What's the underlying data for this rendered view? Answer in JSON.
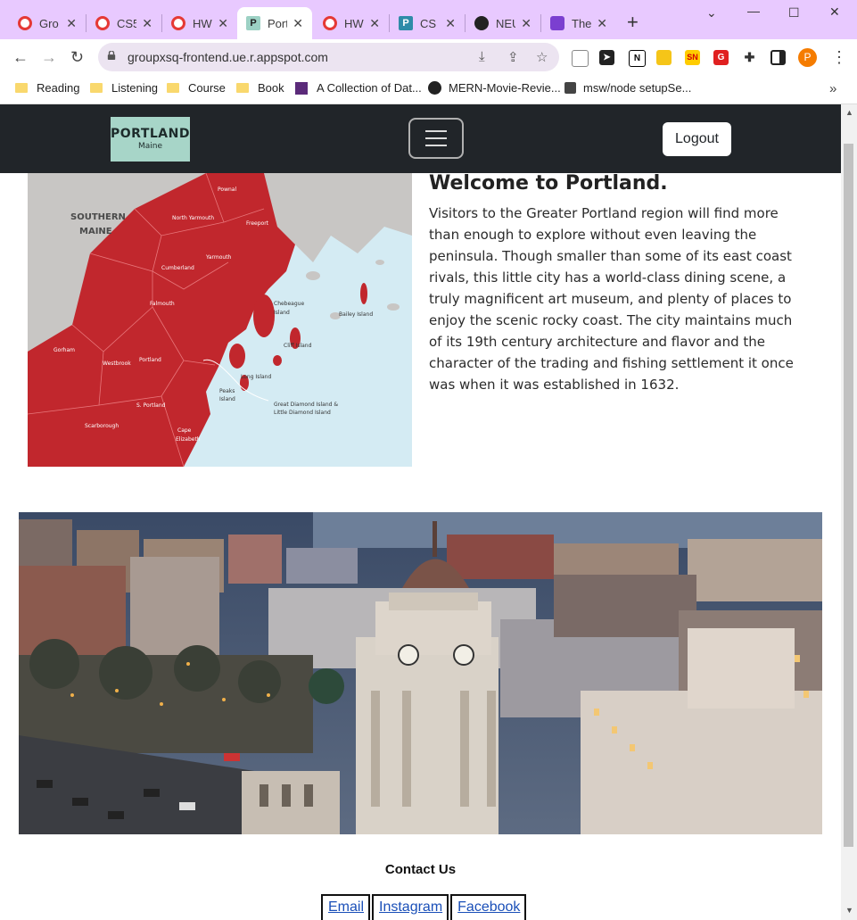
{
  "browser": {
    "tabs": [
      {
        "label": "Gro",
        "icon": "circle-red-icon"
      },
      {
        "label": "CS5",
        "icon": "circle-red-icon"
      },
      {
        "label": "HW",
        "icon": "circle-red-icon"
      },
      {
        "label": "Port",
        "icon": "p-icon",
        "active": true
      },
      {
        "label": "HW",
        "icon": "circle-red-icon"
      },
      {
        "label": "CS 5",
        "icon": "p-icon"
      },
      {
        "label": "NEU",
        "icon": "github-icon"
      },
      {
        "label": "The",
        "icon": "bell-icon"
      }
    ],
    "url": "groupxsq-frontend.ue.r.appspot.com",
    "bookmarks": [
      "Reading",
      "Listening",
      "Course",
      "Book",
      "A Collection of Dat...",
      "MERN-Movie-Revie...",
      "msw/node setupSe..."
    ],
    "profile_initial": "P"
  },
  "site": {
    "logo": {
      "line1": "PORTLAND",
      "line2": "Maine"
    },
    "logout_label": "Logout"
  },
  "map": {
    "region_label": "SOUTHERN\nMAINE",
    "towns": [
      "Pownal",
      "North Yarmouth",
      "Freeport",
      "Cumberland",
      "Yarmouth",
      "Falmouth",
      "Chebeague Island",
      "Bailey Island",
      "Gorham",
      "Westbrook",
      "Portland",
      "Cliff Island",
      "Long Island",
      "Peaks Island",
      "Great Diamond Island & Little Diamond Island",
      "S. Portland",
      "Scarborough",
      "Cape Elizabeth"
    ]
  },
  "welcome": {
    "title": "Welcome to Portland.",
    "body": "Visitors to the Greater Portland region will find more than enough to explore without even leaving the peninsula. Though smaller than some of its east coast rivals, this little city has a world-class dining scene, a truly magnificent art museum, and plenty of places to enjoy the scenic rocky coast. The city maintains much of its 19th century architecture and flavor and the character of the trading and fishing settlement it once was when it was established in 1632."
  },
  "contact": {
    "title": "Contact Us",
    "links": [
      "Email",
      "Instagram",
      "Facebook"
    ]
  },
  "colors": {
    "tabbar": "#e8c9ff",
    "navbar": "#212529",
    "map_red": "#c1272d",
    "water": "#d4ebf3",
    "link": "#1a4fb8"
  }
}
